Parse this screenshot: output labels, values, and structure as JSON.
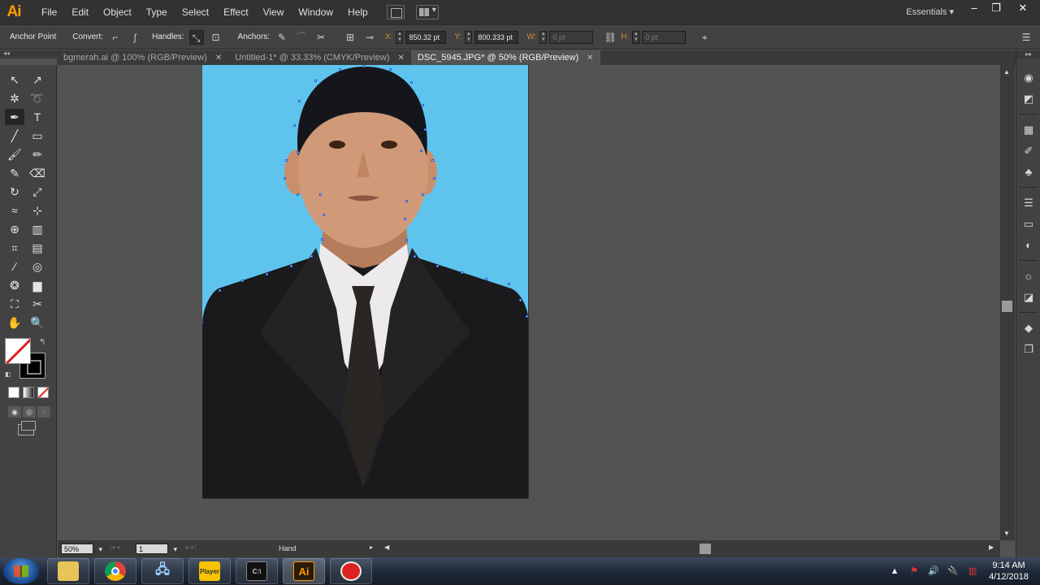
{
  "app": {
    "logo": "Ai",
    "menu": [
      "File",
      "Edit",
      "Object",
      "Type",
      "Select",
      "Effect",
      "View",
      "Window",
      "Help"
    ],
    "workspace": "Essentials",
    "window_controls": [
      "–",
      "❐",
      "✕"
    ]
  },
  "control_bar": {
    "tool_name": "Anchor Point",
    "convert_label": "Convert:",
    "handles_label": "Handles:",
    "anchors_label": "Anchors:",
    "x_label": "X:",
    "x_value": "850.32 pt",
    "y_label": "Y:",
    "y_value": "800.333 pt",
    "w_label": "W:",
    "w_value": "0 pt",
    "h_label": "H:",
    "h_value": "0 pt"
  },
  "tabs": [
    {
      "label": "bgmerah.ai @ 100% (RGB/Preview)",
      "close": "✕",
      "active": false
    },
    {
      "label": "Untitled-1* @ 33.33% (CMYK/Preview)",
      "close": "✕",
      "active": false
    },
    {
      "label": "DSC_5945.JPG* @ 50% (RGB/Preview)",
      "close": "✕",
      "active": true
    }
  ],
  "tools": [
    {
      "name": "selection-tool-icon",
      "glyph": "↖"
    },
    {
      "name": "direct-selection-tool-icon",
      "glyph": "↗"
    },
    {
      "name": "magic-wand-tool-icon",
      "glyph": "✲"
    },
    {
      "name": "lasso-tool-icon",
      "glyph": "➰"
    },
    {
      "name": "pen-tool-icon",
      "glyph": "✒"
    },
    {
      "name": "type-tool-icon",
      "glyph": "T"
    },
    {
      "name": "line-segment-tool-icon",
      "glyph": "╱"
    },
    {
      "name": "rectangle-tool-icon",
      "glyph": "▭"
    },
    {
      "name": "paintbrush-tool-icon",
      "glyph": "🖌"
    },
    {
      "name": "pencil-tool-icon",
      "glyph": "✏"
    },
    {
      "name": "blob-brush-tool-icon",
      "glyph": "✎"
    },
    {
      "name": "eraser-tool-icon",
      "glyph": "⌫"
    },
    {
      "name": "rotate-tool-icon",
      "glyph": "↻"
    },
    {
      "name": "scale-tool-icon",
      "glyph": "⤢"
    },
    {
      "name": "width-tool-icon",
      "glyph": "≈"
    },
    {
      "name": "free-transform-tool-icon",
      "glyph": "⊹"
    },
    {
      "name": "shape-builder-tool-icon",
      "glyph": "⊕"
    },
    {
      "name": "perspective-grid-tool-icon",
      "glyph": "▥"
    },
    {
      "name": "mesh-tool-icon",
      "glyph": "⌗"
    },
    {
      "name": "gradient-tool-icon",
      "glyph": "▤"
    },
    {
      "name": "eyedropper-tool-icon",
      "glyph": "⁄"
    },
    {
      "name": "blend-tool-icon",
      "glyph": "◎"
    },
    {
      "name": "symbol-sprayer-tool-icon",
      "glyph": "❂"
    },
    {
      "name": "column-graph-tool-icon",
      "glyph": "▆"
    },
    {
      "name": "artboard-tool-icon",
      "glyph": "⛶"
    },
    {
      "name": "slice-tool-icon",
      "glyph": "✂"
    },
    {
      "name": "hand-tool-icon",
      "glyph": "✋"
    },
    {
      "name": "zoom-tool-icon",
      "glyph": "🔍"
    }
  ],
  "status_bar": {
    "zoom": "50%",
    "page": "1",
    "current_tool": "Hand"
  },
  "taskbar": {
    "apps": [
      {
        "name": "explorer",
        "label": ""
      },
      {
        "name": "chrome",
        "label": ""
      },
      {
        "name": "network",
        "label": ""
      },
      {
        "name": "player",
        "label": "Player"
      },
      {
        "name": "terminal",
        "label": "C:\\"
      },
      {
        "name": "illustrator",
        "label": "Ai"
      },
      {
        "name": "recorder",
        "label": ""
      }
    ],
    "time": "9:14 AM",
    "date": "4/12/2018"
  },
  "colors": {
    "accent": "#ff9a00",
    "photo_background": "#5ec4ee"
  }
}
